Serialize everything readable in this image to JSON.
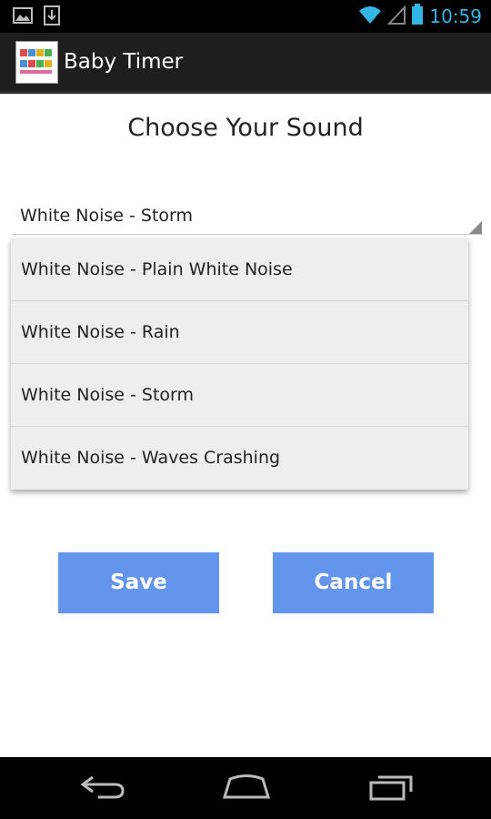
{
  "status_bar": {
    "time": "10:59",
    "left_icons": [
      "image-notification-icon",
      "download-notification-icon"
    ],
    "right_icons": [
      "wifi-icon",
      "signal-icon",
      "battery-icon"
    ]
  },
  "action_bar": {
    "title": "Baby Timer",
    "icon": "baby-timer-app-icon"
  },
  "main": {
    "heading": "Choose Your Sound",
    "spinner": {
      "selected": "White Noise - Storm"
    },
    "dropdown": {
      "options": [
        "White Noise - Plain White Noise",
        "White Noise - Rain",
        "White Noise - Storm",
        "White Noise - Waves Crashing"
      ]
    },
    "buttons": {
      "save": "Save",
      "cancel": "Cancel"
    }
  },
  "nav_bar": {
    "icons": [
      "back-icon",
      "home-icon",
      "recent-apps-icon"
    ]
  },
  "colors": {
    "accent_button": "#6495ed",
    "status_time": "#33b5e5",
    "action_bar": "#1e1e1e",
    "dropdown_bg": "#eeeeee"
  }
}
